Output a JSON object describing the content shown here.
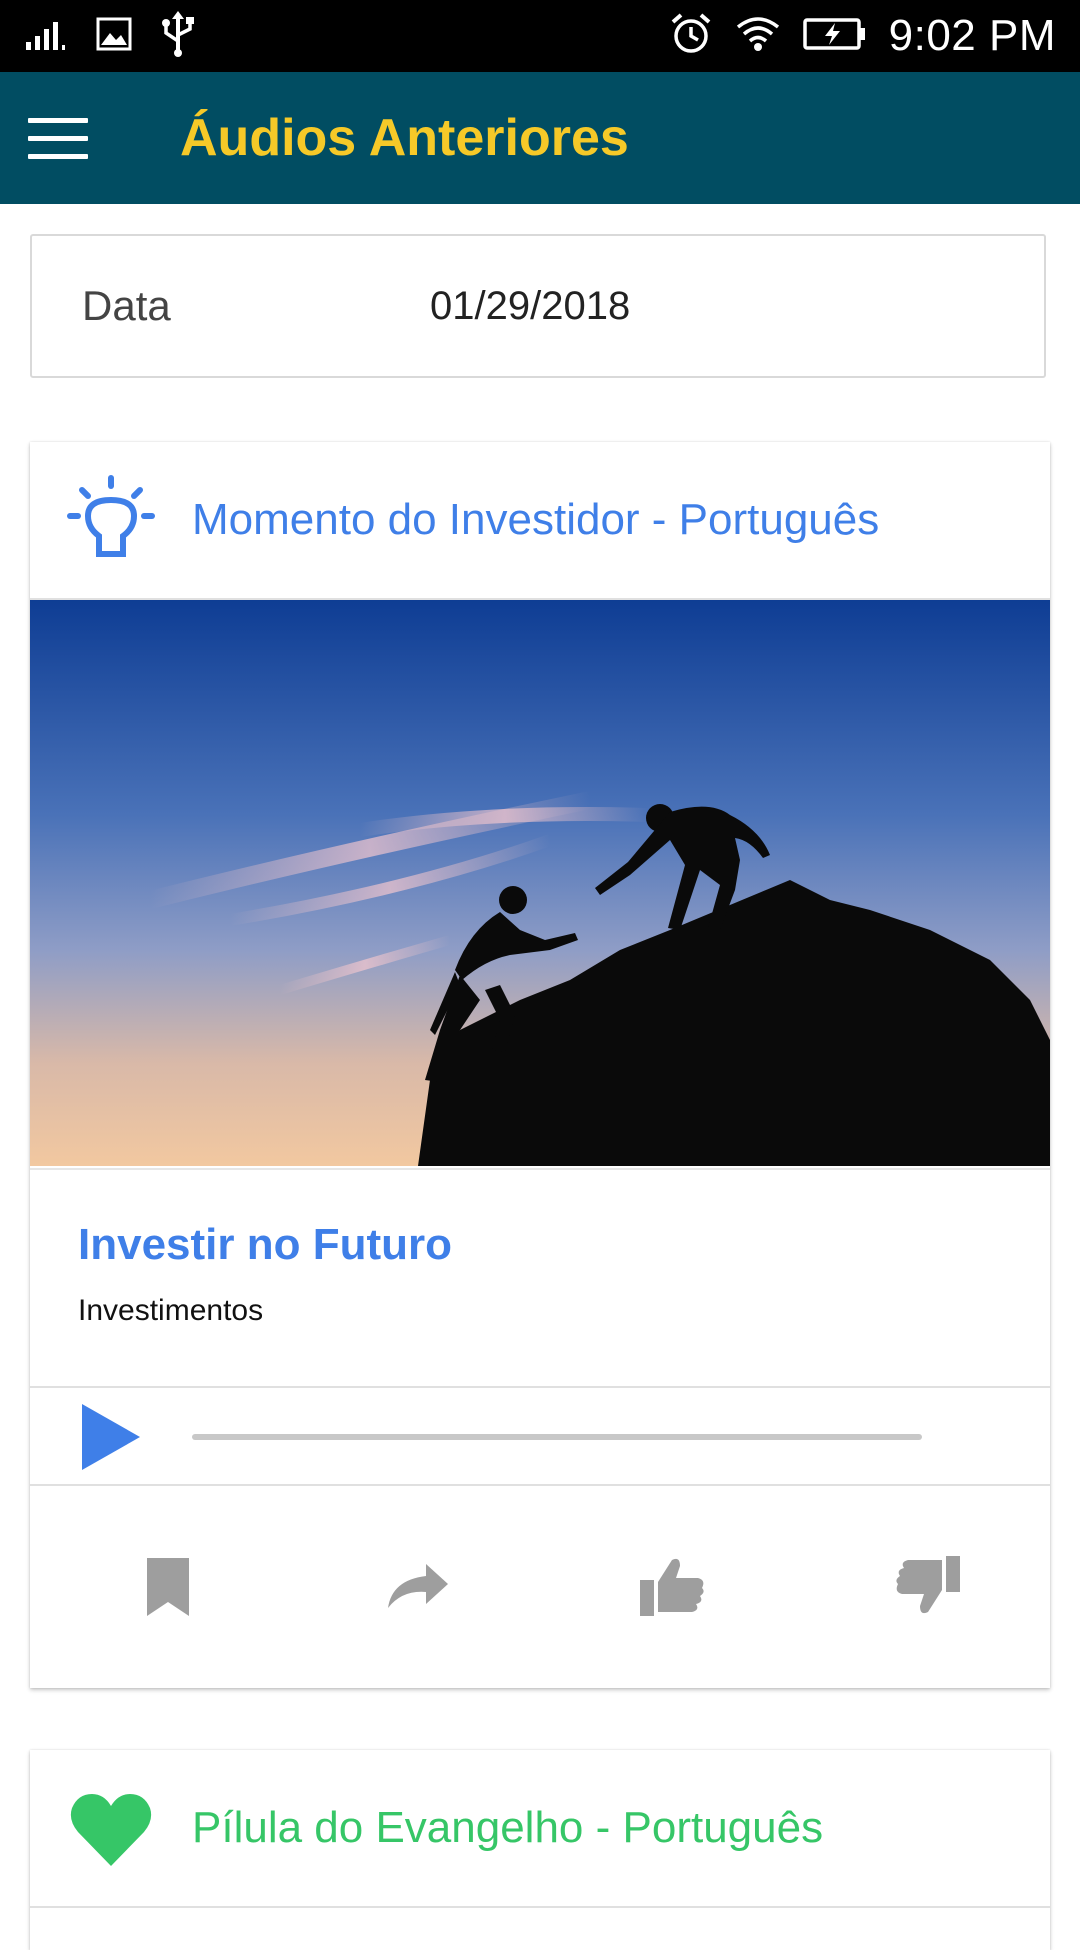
{
  "status_bar": {
    "time": "9:02 PM",
    "left_icons": [
      "signal-icon",
      "image-icon",
      "usb-icon"
    ],
    "right_icons": [
      "alarm-icon",
      "wifi-icon",
      "battery-charging-icon"
    ]
  },
  "toolbar": {
    "title": "Áudios Anteriores",
    "menu_icon": "hamburger-menu-icon",
    "background": "#014d62",
    "title_color": "#f6c928"
  },
  "date_field": {
    "label": "Data",
    "value": "01/29/2018"
  },
  "cards": [
    {
      "icon": "lightbulb-icon",
      "title": "Momento do Investidor - Português",
      "color": "#3f7fe8",
      "image": "silhouette-climbers-helping-hand-image",
      "episode_title": "Investir no Futuro",
      "episode_category": "Investimentos",
      "player": {
        "play_icon": "play-icon",
        "progress": 0
      },
      "actions": [
        "bookmark-icon",
        "share-icon",
        "thumbs-up-icon",
        "thumbs-down-icon"
      ],
      "action_color": "#9e9e9e"
    },
    {
      "icon": "heart-icon",
      "title": "Pílula do Evangelho - Português",
      "color": "#36c667"
    }
  ]
}
